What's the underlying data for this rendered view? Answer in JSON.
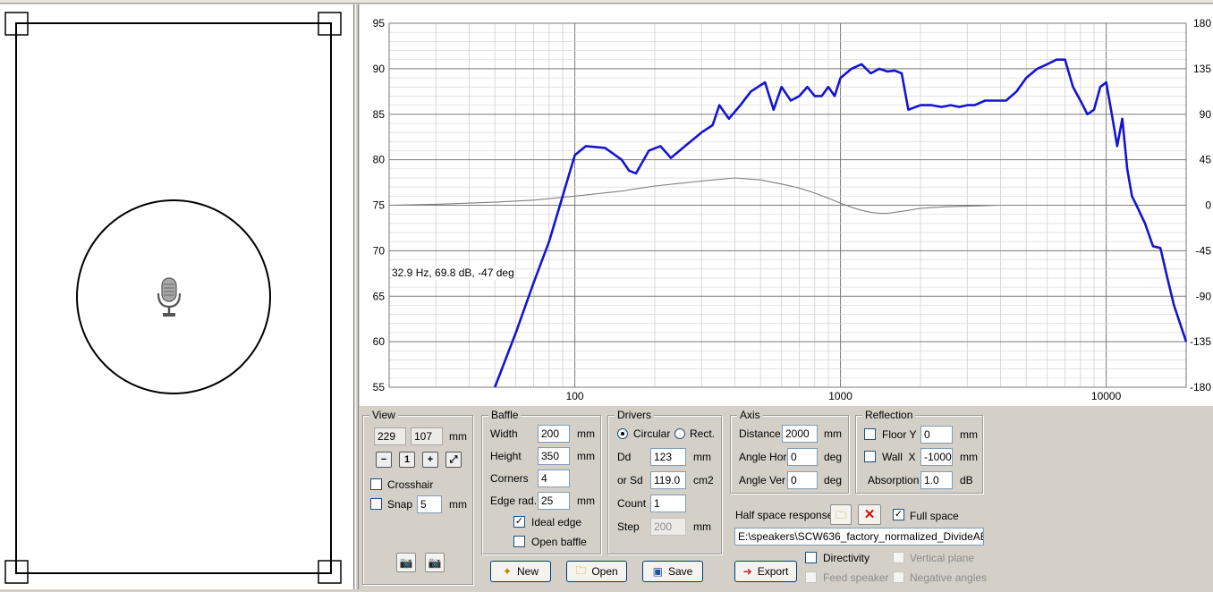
{
  "view": {
    "title": "View",
    "width_value": "229",
    "height_value": "107",
    "unit": "mm",
    "crosshair_label": "Crosshair",
    "snap_label": "Snap",
    "snap_value": "5",
    "snap_unit": "mm",
    "zoom_icons": [
      "zoom-out-icon",
      "zoom-reset-icon",
      "zoom-in-icon",
      "fit-view-icon"
    ]
  },
  "baffle": {
    "title": "Baffle",
    "width_label": "Width",
    "width_value": "200",
    "width_unit": "mm",
    "height_label": "Height",
    "height_value": "350",
    "height_unit": "mm",
    "corners_label": "Corners",
    "corners_value": "4",
    "edge_label": "Edge rad.",
    "edge_value": "25",
    "edge_unit": "mm",
    "ideal_edge_label": "Ideal edge",
    "ideal_edge_checked": true,
    "open_baffle_label": "Open baffle",
    "open_baffle_checked": false
  },
  "drivers": {
    "title": "Drivers",
    "circular_label": "Circular",
    "rect_label": "Rect.",
    "dd_label": "Dd",
    "dd_value": "123",
    "dd_unit": "mm",
    "sd_label": "or Sd",
    "sd_value": "119.0",
    "sd_unit": "cm2",
    "count_label": "Count",
    "count_value": "1",
    "step_label": "Step",
    "step_value": "200",
    "step_unit": "mm"
  },
  "axis": {
    "title": "Axis",
    "distance_label": "Distance",
    "distance_value": "2000",
    "distance_unit": "mm",
    "angle_hor_label": "Angle Hor",
    "angle_hor_value": "0",
    "angle_hor_unit": "deg",
    "angle_ver_label": "Angle Ver",
    "angle_ver_value": "0",
    "angle_ver_unit": "deg"
  },
  "reflection": {
    "title": "Reflection",
    "floor_label": "Floor Y",
    "floor_value": "0",
    "floor_unit": "mm",
    "wall_label": "Wall  X",
    "wall_value": "-1000",
    "wall_unit": "mm",
    "absorption_label": "Absorption",
    "absorption_value": "1.0",
    "absorption_unit": "dB"
  },
  "half_space": {
    "label": "Half space response",
    "full_space_label": "Full space",
    "full_space_checked": true,
    "file_path": "E:\\speakers\\SCW636_factory_normalized_DivideAB.txt"
  },
  "buttons": {
    "new_label": "New",
    "open_label": "Open",
    "save_label": "Save",
    "export_label": "Export"
  },
  "options": {
    "directivity_label": "Directivity",
    "feed_speaker_label": "Feed speaker",
    "vertical_plane_label": "Vertical plane",
    "negative_angles_label": "Negative angles"
  },
  "graph": {
    "readout": "32.9 Hz, 69.8 dB, -47 deg",
    "colors": {
      "spl": "#1414d2",
      "phase": "#808080",
      "grid": "#b4b4b4"
    }
  },
  "chart_data": {
    "type": "line",
    "x_scale": "log",
    "xlim": [
      20,
      20000
    ],
    "ylim": [
      55,
      95
    ],
    "y2lim": [
      -180,
      180
    ],
    "x_ticks": [
      "100",
      "1000",
      "10000"
    ],
    "y_ticks": [
      "95",
      "90",
      "85",
      "80",
      "75",
      "70",
      "65",
      "60",
      "55"
    ],
    "y2_ticks": [
      "180",
      "135",
      "90",
      "45",
      "0",
      "-45",
      "-90",
      "-135",
      "-180"
    ],
    "grid": true,
    "series": [
      {
        "axis": "left",
        "x": [
          50,
          60,
          70,
          80,
          90,
          100,
          110,
          130,
          150,
          160,
          170,
          190,
          210,
          230,
          260,
          300,
          330,
          350,
          380,
          420,
          460,
          520,
          560,
          600,
          650,
          700,
          750,
          800,
          850,
          900,
          950,
          1000,
          1100,
          1200,
          1300,
          1400,
          1500,
          1600,
          1700,
          1800,
          2000,
          2200,
          2400,
          2600,
          2800,
          3000,
          3200,
          3500,
          3800,
          4200,
          4600,
          5000,
          5500,
          6000,
          6500,
          7000,
          7500,
          8000,
          8500,
          9000,
          9500,
          10000,
          10500,
          11000,
          11500,
          12000,
          12500,
          13000,
          14000,
          15000,
          16000,
          17000,
          18000,
          20000
        ],
        "values": [
          55.0,
          61.0,
          66.5,
          71.0,
          76.0,
          80.5,
          81.5,
          81.3,
          80.0,
          78.8,
          78.5,
          81.0,
          81.5,
          80.2,
          81.5,
          83.0,
          83.8,
          86.0,
          84.5,
          86.0,
          87.5,
          88.5,
          85.5,
          88.0,
          86.5,
          87.0,
          88.0,
          87.0,
          87.0,
          88.0,
          87.0,
          89.0,
          90.0,
          90.5,
          89.5,
          90.0,
          89.7,
          89.8,
          89.5,
          85.5,
          86.0,
          86.0,
          85.8,
          86.0,
          85.8,
          86.0,
          86.0,
          86.5,
          86.5,
          86.5,
          87.5,
          89.0,
          90.0,
          90.5,
          91.0,
          91.0,
          88.0,
          86.5,
          85.0,
          85.5,
          88.0,
          88.5,
          85.0,
          81.5,
          84.5,
          79.0,
          76.0,
          75.0,
          73.0,
          70.5,
          70.3,
          67.0,
          64.0,
          60.0
        ]
      },
      {
        "axis": "right",
        "x": [
          20,
          30,
          50,
          70,
          100,
          150,
          200,
          300,
          400,
          500,
          600,
          700,
          800,
          900,
          1000,
          1100,
          1200,
          1300,
          1400,
          1500,
          1600,
          1700,
          1800,
          2000,
          2500,
          3000,
          4000,
          5000,
          7000,
          10000,
          14000,
          20000
        ],
        "values": [
          0,
          1.0,
          3.0,
          5.0,
          9.0,
          14.0,
          19.0,
          24.0,
          27.0,
          25.0,
          21.0,
          17.0,
          12.0,
          7.0,
          2.0,
          -2.0,
          -5.0,
          -7.0,
          -8.0,
          -8.0,
          -7.0,
          -6.0,
          -5.0,
          -3.0,
          -1.5,
          -1.0,
          0,
          0,
          0,
          0,
          0,
          0
        ]
      }
    ]
  }
}
